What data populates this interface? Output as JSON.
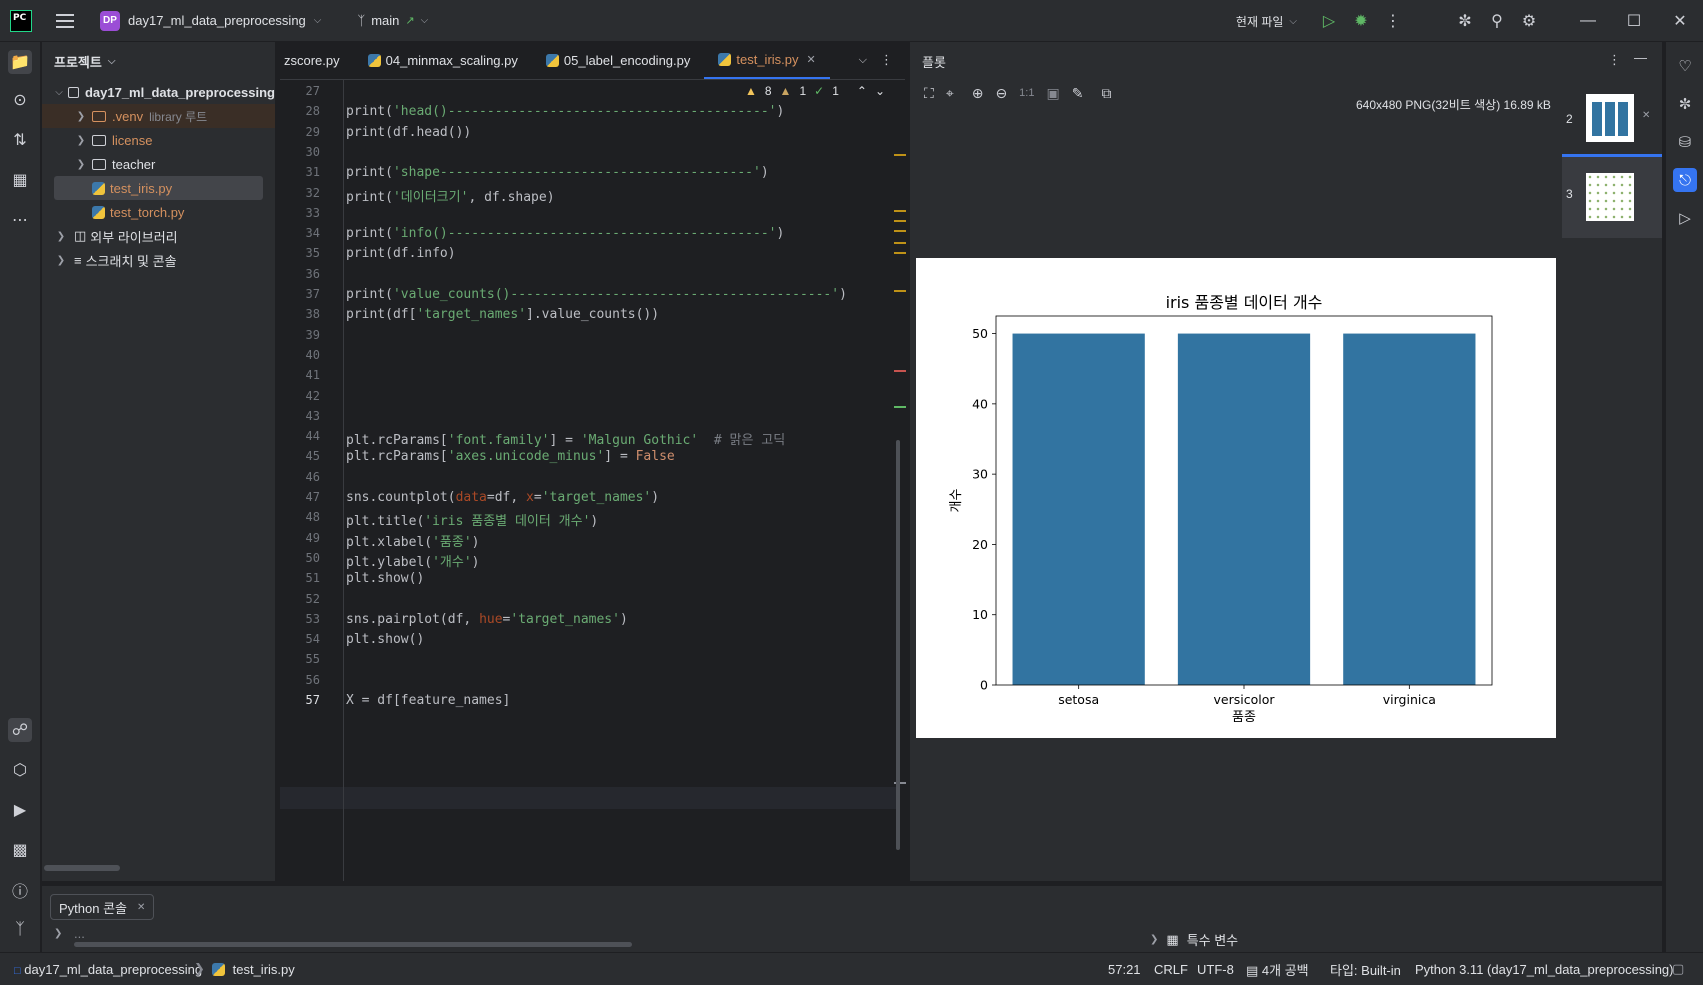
{
  "titlebar": {
    "logo": "PC",
    "project_badge": "DP",
    "project_name": "day17_ml_data_preprocessing",
    "branch": "main",
    "run_config": "현재 파일"
  },
  "project_panel": {
    "title": "프로젝트",
    "root": "day17_ml_data_preprocessing",
    "items": [
      {
        "label": ".venv",
        "suffix": "library 루트"
      },
      {
        "label": "license"
      },
      {
        "label": "teacher"
      },
      {
        "label": "test_iris.py"
      },
      {
        "label": "test_torch.py"
      },
      {
        "label": "외부 라이브러리"
      },
      {
        "label": "스크래치 및 콘솔"
      }
    ]
  },
  "editor": {
    "tabs": [
      "zscore.py",
      "04_minmax_scaling.py",
      "05_label_encoding.py",
      "test_iris.py"
    ],
    "inspections": {
      "warnings": "8",
      "weak": "1",
      "ok": "1"
    },
    "lines": [
      {
        "n": "27",
        "t": ""
      },
      {
        "n": "28",
        "t": "print('head()-----------------------------------------')"
      },
      {
        "n": "29",
        "t": "print(df.head())"
      },
      {
        "n": "30",
        "t": ""
      },
      {
        "n": "31",
        "t": "print('shape----------------------------------------')"
      },
      {
        "n": "32",
        "t": "print('데이터크기', df.shape)"
      },
      {
        "n": "33",
        "t": ""
      },
      {
        "n": "34",
        "t": "print('info()-----------------------------------------')"
      },
      {
        "n": "35",
        "t": "print(df.info)"
      },
      {
        "n": "36",
        "t": ""
      },
      {
        "n": "37",
        "t": "print('value_counts()-----------------------------------------')"
      },
      {
        "n": "38",
        "t": "print(df['target_names'].value_counts())"
      },
      {
        "n": "39",
        "t": ""
      },
      {
        "n": "40",
        "t": ""
      },
      {
        "n": "41",
        "t": ""
      },
      {
        "n": "42",
        "t": ""
      },
      {
        "n": "43",
        "t": ""
      },
      {
        "n": "44",
        "t": "plt.rcParams['font.family'] = 'Malgun Gothic'  # 맑은 고딕"
      },
      {
        "n": "45",
        "t": "plt.rcParams['axes.unicode_minus'] = False"
      },
      {
        "n": "46",
        "t": ""
      },
      {
        "n": "47",
        "t": "sns.countplot(data=df, x='target_names')"
      },
      {
        "n": "48",
        "t": "plt.title('iris 품종별 데이터 개수')"
      },
      {
        "n": "49",
        "t": "plt.xlabel('품종')"
      },
      {
        "n": "50",
        "t": "plt.ylabel('개수')"
      },
      {
        "n": "51",
        "t": "plt.show()"
      },
      {
        "n": "52",
        "t": ""
      },
      {
        "n": "53",
        "t": "sns.pairplot(df, hue='target_names')"
      },
      {
        "n": "54",
        "t": "plt.show()"
      },
      {
        "n": "55",
        "t": ""
      },
      {
        "n": "56",
        "t": ""
      },
      {
        "n": "57",
        "t": "X = df[feature_names]"
      }
    ]
  },
  "plots": {
    "title": "플롯",
    "image_info": "640x480 PNG(32비트 색상) 16.89 kB",
    "zoom_label": "1:1",
    "thumbnails": [
      "2",
      "3"
    ]
  },
  "chart_data": {
    "type": "bar",
    "title": "iris 품종별 데이터 개수",
    "xlabel": "품종",
    "ylabel": "개수",
    "categories": [
      "setosa",
      "versicolor",
      "virginica"
    ],
    "values": [
      50,
      50,
      50
    ],
    "ylim": [
      0,
      52.5
    ],
    "yticks": [
      "0",
      "10",
      "20",
      "30",
      "40",
      "50"
    ],
    "bar_color": "#3274a1",
    "grid": false
  },
  "bottom_panel": {
    "tab": "Python 콘솔",
    "special_vars": "특수 변수",
    "prompt": "..."
  },
  "status": {
    "breadcrumb_project": "day17_ml_data_preprocessing",
    "breadcrumb_file": "test_iris.py",
    "position": "57:21",
    "line_sep": "CRLF",
    "encoding": "UTF-8",
    "indent": "4개 공백",
    "type": "타입: Built-in",
    "interpreter": "Python 3.11 (day17_ml_data_preprocessing)"
  }
}
